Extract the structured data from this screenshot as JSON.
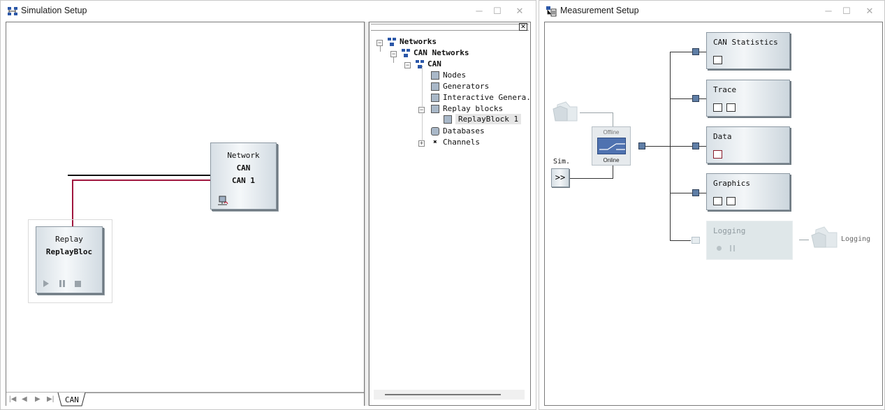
{
  "simulation_window": {
    "title": "Simulation Setup",
    "network_block": {
      "label": "Network",
      "bus": "CAN",
      "name": "CAN 1"
    },
    "replay_block": {
      "label": "Replay",
      "name": "ReplayBloc"
    },
    "sheet_tab": "CAN",
    "tree": {
      "root": "Networks",
      "child": "CAN Networks",
      "network": "CAN",
      "items": [
        "Nodes",
        "Generators",
        "Interactive Genera.",
        "Replay blocks",
        "Databases",
        "Channels"
      ],
      "replay_child": "ReplayBlock 1"
    }
  },
  "measurement_window": {
    "title": "Measurement Setup",
    "switch_top": "Offline",
    "switch_bottom": "Online",
    "sim_label": "Sim.",
    "sim_button": ">>",
    "blocks": [
      "CAN Statistics",
      "Trace",
      "Data",
      "Graphics",
      "Logging"
    ],
    "logging_target": "Logging"
  },
  "icons": [
    "network-icon",
    "minimize-icon",
    "maximize-icon",
    "close-icon",
    "play-icon",
    "pause-icon",
    "stop-icon",
    "folder-icon",
    "trace-icon",
    "graphics-icon"
  ],
  "colors": {
    "bus_line": "#111111",
    "replay_line": "#a0163e",
    "port": "#5f7ea6",
    "switch": "#4f72b0"
  }
}
